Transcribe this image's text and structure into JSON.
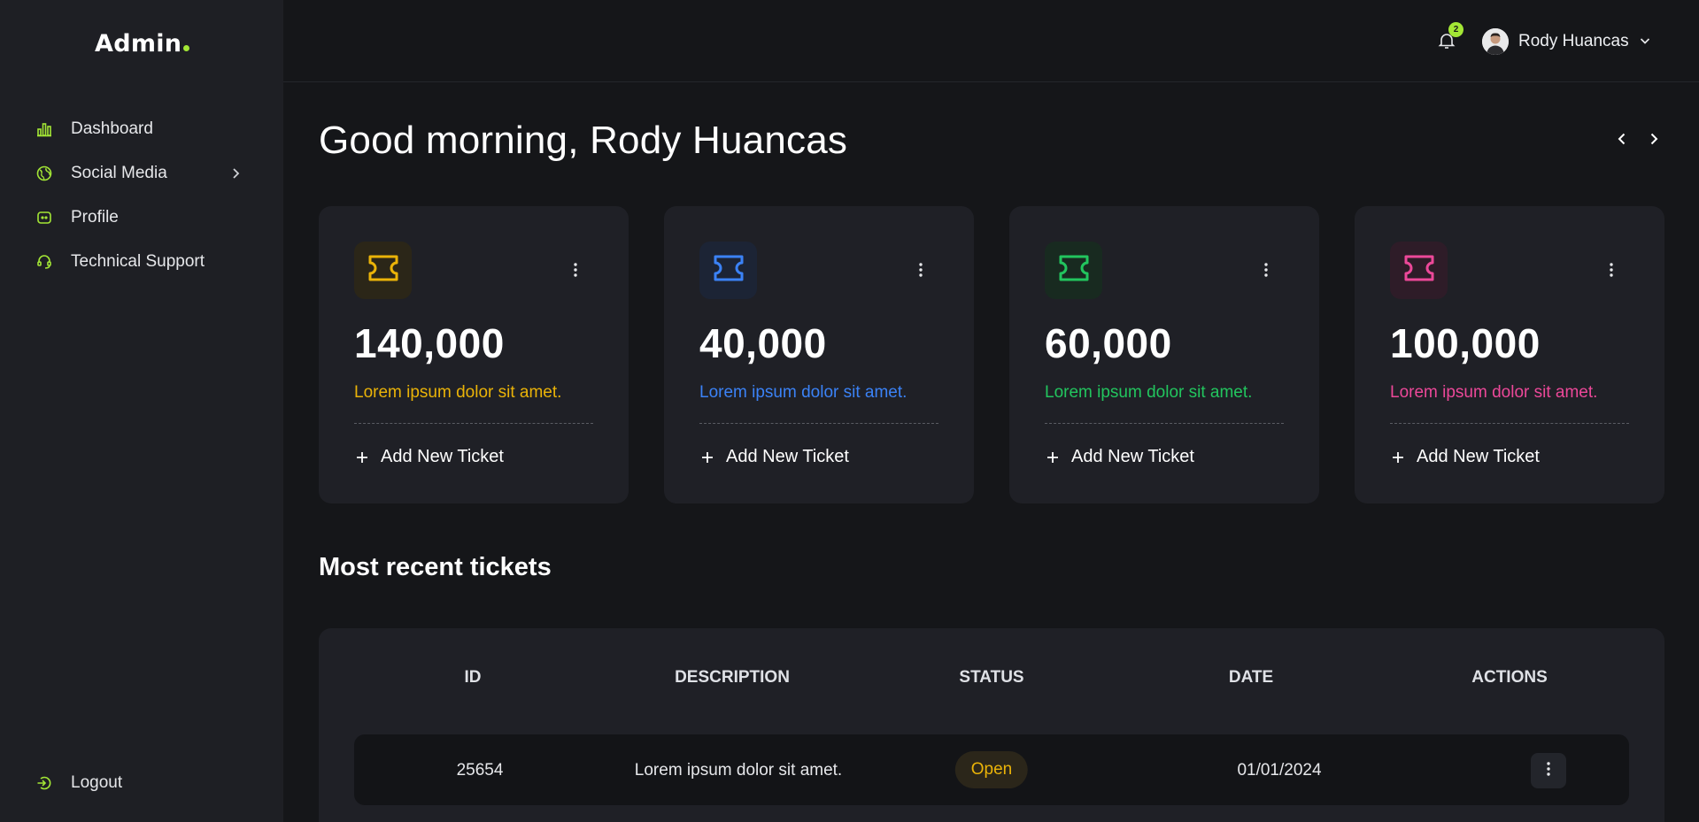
{
  "brand": {
    "name": "Admin"
  },
  "sidebar": {
    "items": [
      {
        "label": "Dashboard",
        "icon": "bar-chart-icon"
      },
      {
        "label": "Social Media",
        "icon": "globe-icon",
        "has_submenu": true
      },
      {
        "label": "Profile",
        "icon": "profile-icon"
      },
      {
        "label": "Technical Support",
        "icon": "headset-icon"
      }
    ],
    "logout": {
      "label": "Logout",
      "icon": "logout-icon"
    }
  },
  "header": {
    "notifications": {
      "count": "2"
    },
    "user": {
      "name": "Rody Huancas"
    }
  },
  "main": {
    "greeting": "Good morning, Rody Huancas",
    "cards": [
      {
        "value": "140,000",
        "description": "Lorem ipsum dolor sit amet.",
        "action": "Add New Ticket",
        "color": "#eab308",
        "icon_bg": "#2b2618"
      },
      {
        "value": "40,000",
        "description": "Lorem ipsum dolor sit amet.",
        "action": "Add New Ticket",
        "color": "#3b82f6",
        "icon_bg": "#1c2435"
      },
      {
        "value": "60,000",
        "description": "Lorem ipsum dolor sit amet.",
        "action": "Add New Ticket",
        "color": "#22c55e",
        "icon_bg": "#182a20"
      },
      {
        "value": "100,000",
        "description": "Lorem ipsum dolor sit amet.",
        "action": "Add New Ticket",
        "color": "#ec4899",
        "icon_bg": "#2e1c28"
      }
    ],
    "recent_title": "Most recent tickets",
    "table": {
      "columns": [
        "ID",
        "DESCRIPTION",
        "STATUS",
        "DATE",
        "ACTIONS"
      ],
      "rows": [
        {
          "id": "25654",
          "description": "Lorem ipsum dolor sit amet.",
          "status": "Open",
          "date": "01/01/2024"
        }
      ]
    }
  },
  "colors": {
    "accent": "#a3e635",
    "sidebar_bg": "#1e1f24",
    "page_bg": "#151619"
  }
}
